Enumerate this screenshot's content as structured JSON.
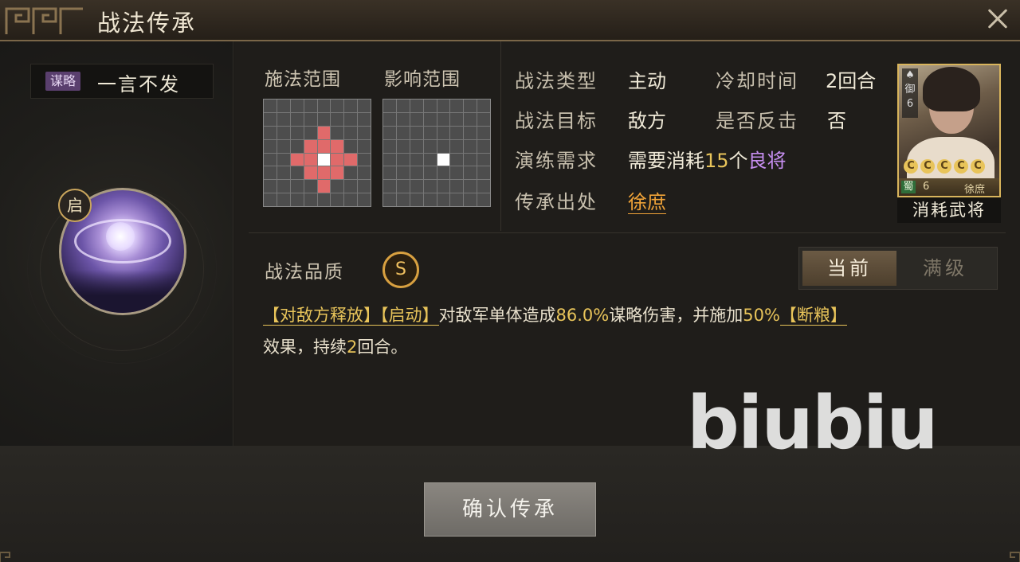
{
  "window": {
    "title": "战法传承"
  },
  "skill": {
    "type_badge": "谋略",
    "name": "一言不发",
    "icon_badge": "启"
  },
  "ranges": {
    "cast_label": "施法范围",
    "effect_label": "影响范围"
  },
  "info": {
    "type_label": "战法类型",
    "type_value": "主动",
    "cooldown_label": "冷却时间",
    "cooldown_value": "2回合",
    "target_label": "战法目标",
    "target_value": "敌方",
    "counter_label": "是否反击",
    "counter_value": "否",
    "drill_label": "演练需求",
    "drill_prefix": "需要消耗",
    "drill_count": "15",
    "drill_unit": "个",
    "drill_item": "良将",
    "source_label": "传承出处",
    "source_value": "徐庶"
  },
  "general": {
    "unit_type": "御",
    "unit_level": "6",
    "faction": "蜀",
    "level": "6",
    "name": "徐庶",
    "star_glyph": "C",
    "stars": 5,
    "consume_label": "消耗武将"
  },
  "quality": {
    "label": "战法品质",
    "grade": "S"
  },
  "toggle": {
    "current": "当前",
    "max": "满级"
  },
  "description": {
    "tag1": "【对敌方释放】",
    "tag2": "【启动】",
    "t1": "对敌军单体造成",
    "damage": "86.0%",
    "t2": "谋略伤害，并施加",
    "chance": "50%",
    "tag3": "【断粮】",
    "t3": "效果，持续",
    "turns": "2",
    "t4": "回合。"
  },
  "confirm_button": "确认传承",
  "watermark": "biubiu",
  "colors": {
    "gold": "#e8c45a",
    "purple": "#c68ef0",
    "orange": "#f0a338",
    "range_red": "#e06a6a"
  }
}
